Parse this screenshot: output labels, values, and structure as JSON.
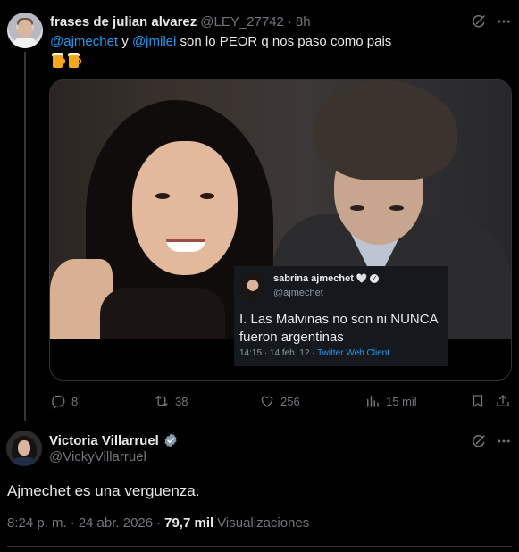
{
  "reply_context": {
    "author_name": "frases de julian alvarez",
    "author_handle": "@LEY_27742",
    "dot": "·",
    "time": "8h",
    "text_mention_1": "@ajmechet",
    "text_connector": " y ",
    "text_mention_2": "@jmilei",
    "text_rest": " son lo PEOR q nos paso como pais",
    "emojis": [
      "beer-mug-icon",
      "beer-mug-icon"
    ],
    "embedded_screenshot": {
      "name": "sabrina ajmechet",
      "heart": "🤍",
      "handle": "@ajmechet",
      "text": "I. Las Malvinas no son ni NUNCA fueron argentinas",
      "time": "14:15 · 14 feb. 12 ·",
      "client": "Twitter Web Client"
    },
    "actions": {
      "replies": "8",
      "retweets": "38",
      "likes": "256",
      "views": "15 mil"
    }
  },
  "main_tweet": {
    "author_name": "Victoria Villarruel",
    "author_handle": "@VickyVillarruel",
    "text": "Ajmechet es una verguenza.",
    "time": "8:24 p. m.",
    "dot": "·",
    "date": "24 abr. 2026",
    "views_count": "79,7 mil",
    "views_label": "Visualizaciones"
  },
  "colors": {
    "background": "#000000",
    "text": "#e7e9ea",
    "muted": "#71767b",
    "accent": "#1d9bf0",
    "border": "#2f3336"
  }
}
